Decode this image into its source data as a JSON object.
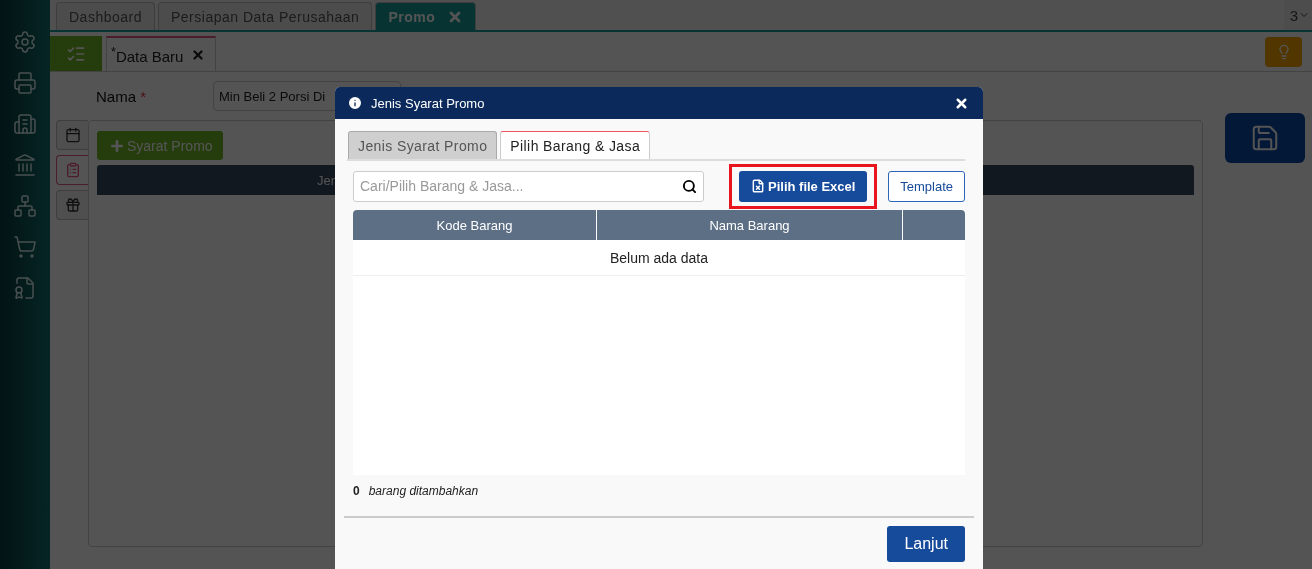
{
  "top_tabs": [
    {
      "label": "Dashboard",
      "selected": false
    },
    {
      "label": "Persiapan Data Perusahaan",
      "selected": false
    },
    {
      "label": "Promo",
      "selected": true
    }
  ],
  "tab_count": "3",
  "doc_tab": {
    "label": "$^{*}$Data Baru"
  },
  "form": {
    "label": "Nama",
    "required": true,
    "required_mark": "*",
    "value": "Min Beli 2 Porsi Di"
  },
  "side_tabs": [
    {
      "kind": "calendar",
      "selected": false
    },
    {
      "kind": "clipboard",
      "selected": true
    },
    {
      "kind": "gift",
      "selected": false
    }
  ],
  "add_button": "Syarat Promo",
  "table_header": "Jen",
  "modal": {
    "title": "Jenis Syarat Promo",
    "tabs": [
      {
        "label": "Jenis Syarat Promo",
        "selected": false
      },
      {
        "label": "Pilih Barang & Jasa",
        "selected": true
      }
    ],
    "search": {
      "placeholder": "Cari/Pilih Barang & Jasa..."
    },
    "excel_button": {
      "label": "Pilih file Excel",
      "highlighted": true
    },
    "template_button": "Template",
    "columns": [
      "Kode Barang",
      "Nama Barang"
    ],
    "empty_text": "Belum ada data",
    "count": "0",
    "count_label": "barang ditambahkan",
    "next_button": "Lanjut"
  }
}
